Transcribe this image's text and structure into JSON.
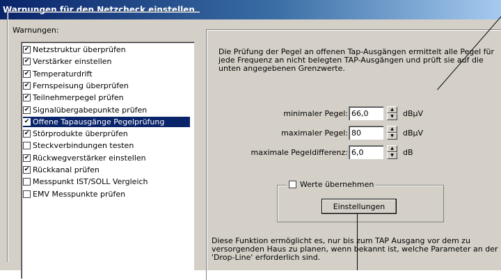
{
  "window": {
    "title": "Warnungen für den Netzcheck einstellen"
  },
  "warnings_group": {
    "label": "Warnungen:",
    "items": [
      {
        "label": "Netzstruktur überprüfen",
        "checked": true,
        "selected": false
      },
      {
        "label": "Verstärker einstellen",
        "checked": true,
        "selected": false
      },
      {
        "label": "Temperaturdrift",
        "checked": true,
        "selected": false
      },
      {
        "label": "Fernspeisung überprüfen",
        "checked": true,
        "selected": false
      },
      {
        "label": "Teilnehmerpegel prüfen",
        "checked": true,
        "selected": false
      },
      {
        "label": "Signalübergabepunkte prüfen",
        "checked": true,
        "selected": false
      },
      {
        "label": "Offene Tapausgänge Pegelprüfung",
        "checked": true,
        "selected": true
      },
      {
        "label": "Störprodukte überprüfen",
        "checked": true,
        "selected": false
      },
      {
        "label": "Steckverbindungen testen",
        "checked": false,
        "selected": false
      },
      {
        "label": "Rückwegverstärker einstellen",
        "checked": true,
        "selected": false
      },
      {
        "label": "Rückkanal prüfen",
        "checked": true,
        "selected": false
      },
      {
        "label": "Messpunkt IST/SOLL Vergleich",
        "checked": false,
        "selected": false
      },
      {
        "label": "EMV Messpunkte prüfen",
        "checked": false,
        "selected": false
      }
    ]
  },
  "details": {
    "description": "Die Prüfung der Pegel an offenen Tap-Ausgängen ermittelt alle Pegel für jede Frequenz an nicht belegten TAP-Ausgängen und prüft sie auf die unten angegebenen Grenzwerte.",
    "min_level": {
      "label": "minimaler Pegel:",
      "value": "66,0",
      "unit": "dBµV"
    },
    "max_level": {
      "label": "maximaler Pegel:",
      "value": "80",
      "unit": "dBµV"
    },
    "max_diff": {
      "label": "maximale Pegeldifferenz:",
      "value": "6,0",
      "unit": "dB"
    },
    "adopt_values": {
      "label": "Werte übernehmen",
      "checked": false
    },
    "settings_button": "Einstellungen",
    "footer_text": "Diese Funktion ermöglicht es, nur bis zum TAP Ausgang vor dem zu versorgenden Haus zu planen, wenn bekannt ist, welche Parameter an der 'Drop-Line' erforderlich sind."
  }
}
